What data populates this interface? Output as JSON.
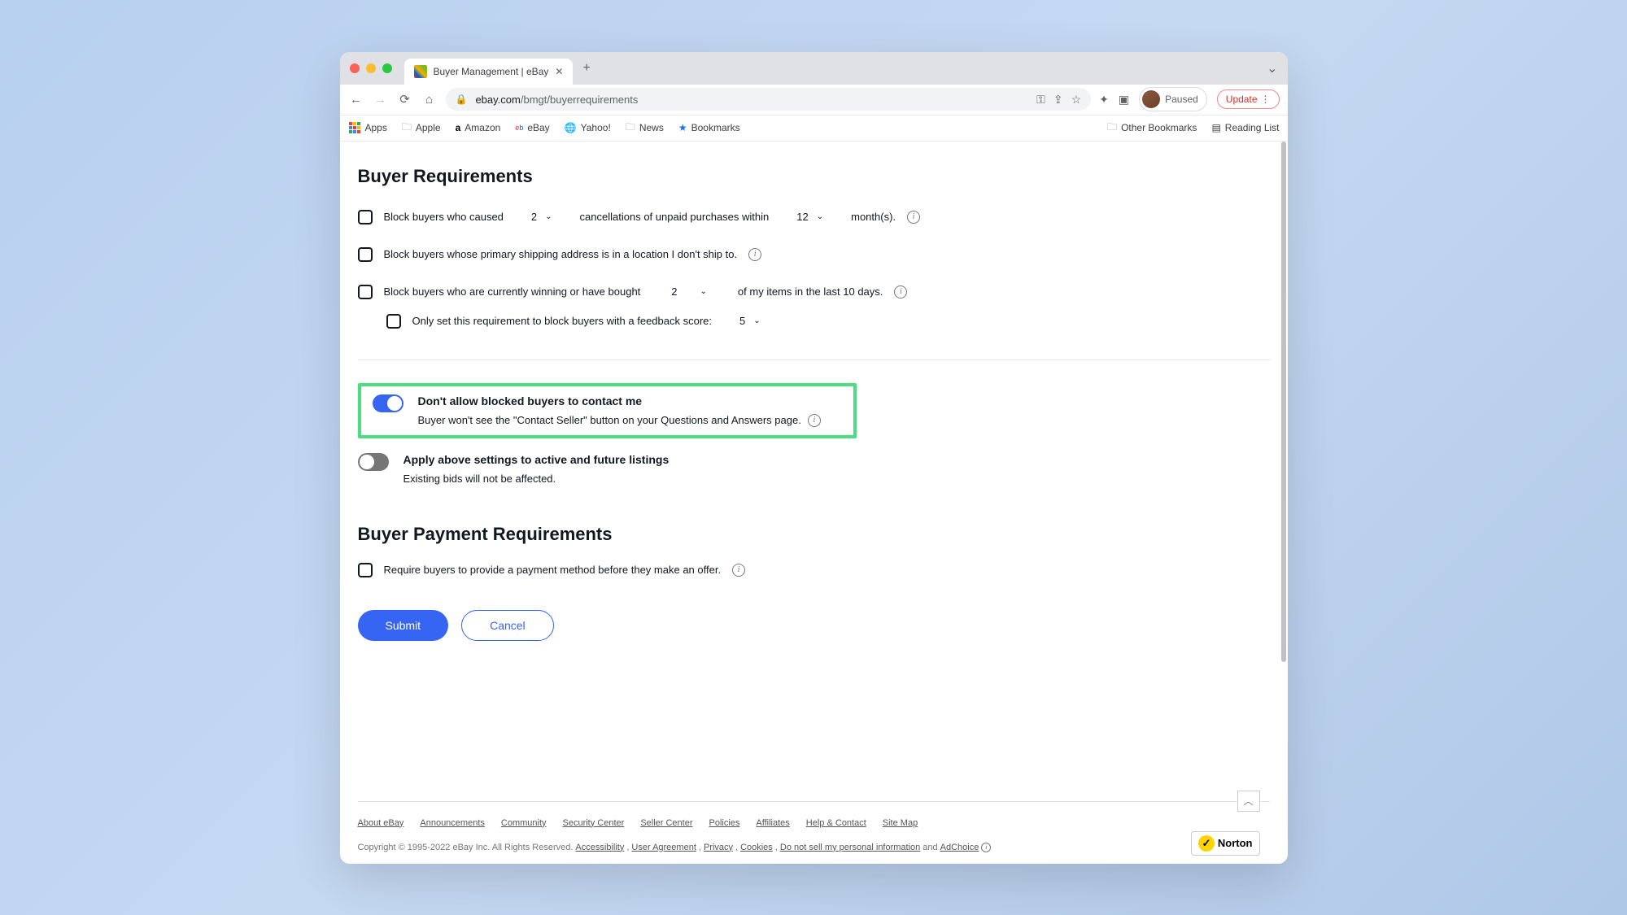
{
  "browser": {
    "tab_title": "Buyer Management | eBay",
    "url_domain": "ebay.com",
    "url_path": "/bmgt/buyerrequirements",
    "paused": "Paused",
    "update": "Update"
  },
  "bookmarks": {
    "apps": "Apps",
    "apple": "Apple",
    "amazon": "Amazon",
    "ebay": "eBay",
    "yahoo": "Yahoo!",
    "news": "News",
    "bookmarks": "Bookmarks",
    "other": "Other Bookmarks",
    "reading": "Reading List"
  },
  "page": {
    "h1": "Buyer Requirements",
    "req1": {
      "pre": "Block buyers who caused",
      "val": "2",
      "mid": "cancellations of unpaid purchases within",
      "months": "12",
      "post": "month(s)."
    },
    "req2": "Block buyers whose primary shipping address is in a location I don't ship to.",
    "req3": {
      "pre": "Block buyers who are currently winning or have bought",
      "val": "2",
      "post": "of my items in the last 10 days."
    },
    "req3_sub": {
      "pre": "Only set this requirement to block buyers with a feedback score:",
      "val": "5"
    },
    "toggle1": {
      "title": "Don't allow blocked buyers to contact me",
      "desc": "Buyer won't see the \"Contact Seller\" button on your Questions and Answers page."
    },
    "toggle2": {
      "title": "Apply above settings to active and future listings",
      "desc": "Existing bids will not be affected."
    },
    "h2": "Buyer Payment Requirements",
    "pay_req": "Require buyers to provide a payment method before they make an offer.",
    "submit": "Submit",
    "cancel": "Cancel"
  },
  "footer": {
    "links": [
      "About eBay",
      "Announcements",
      "Community",
      "Security Center",
      "Seller Center",
      "Policies",
      "Affiliates",
      "Help & Contact",
      "Site Map"
    ],
    "copyright": "Copyright © 1995-2022 eBay Inc. All Rights Reserved.",
    "legal": [
      "Accessibility",
      "User Agreement",
      "Privacy",
      "Cookies",
      "Do not sell my personal information"
    ],
    "and": "and",
    "adchoice": "AdChoice",
    "norton": "Norton"
  }
}
